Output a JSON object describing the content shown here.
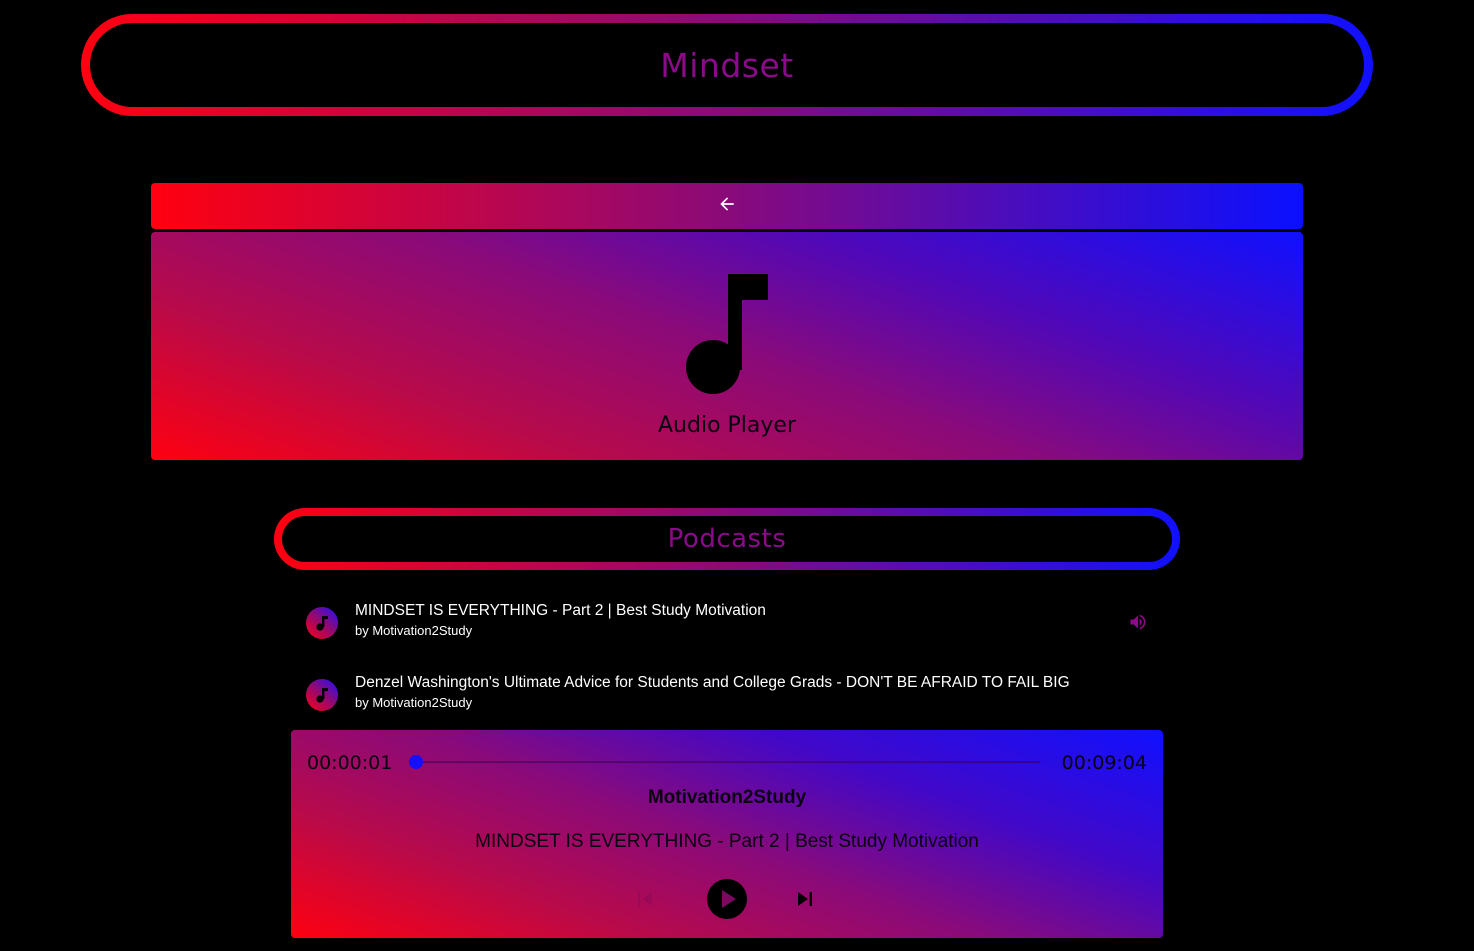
{
  "header": {
    "title": "Mindset"
  },
  "hero": {
    "label": "Audio Player"
  },
  "podcasts": {
    "heading": "Podcasts",
    "items": [
      {
        "title": "MINDSET IS EVERYTHING - Part 2 | Best Study Motivation",
        "author": "by Motivation2Study",
        "playing": true
      },
      {
        "title": "Denzel Washington's Ultimate Advice for Students and College Grads - DON'T BE AFRAID TO FAIL BIG",
        "author": "by Motivation2Study",
        "playing": false
      }
    ]
  },
  "player": {
    "current_time": "00:00:01",
    "total_time": "00:09:04",
    "progress_fraction": 0.002,
    "artist": "Motivation2Study",
    "track": "MINDSET IS EVERYTHING - Part 2 | Best Study Motivation"
  },
  "icons": {
    "back": "arrow-left-icon",
    "hero": "music-note-icon",
    "list_avatar": "music-note-icon",
    "now_playing": "volume-icon",
    "prev": "skip-previous-icon",
    "play": "play-circle-icon",
    "next": "skip-next-icon"
  },
  "colors": {
    "gradient_start": "#ff0010",
    "gradient_mid": "#8a0a7a",
    "gradient_end": "#1010ff",
    "title_text": "#8b0a8a",
    "background": "#000000"
  }
}
